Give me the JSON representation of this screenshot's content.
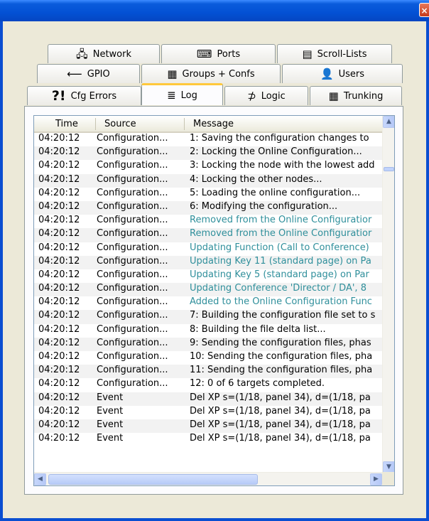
{
  "window": {
    "close_glyph": "×"
  },
  "tabs": {
    "row1": [
      {
        "label": "Network",
        "icon": "network-icon",
        "glyph": "🖧"
      },
      {
        "label": "Ports",
        "icon": "ports-icon",
        "glyph": "⌨"
      },
      {
        "label": "Scroll-Lists",
        "icon": "scroll-lists-icon",
        "glyph": "▤"
      }
    ],
    "row2": [
      {
        "label": "GPIO",
        "icon": "gpio-icon",
        "glyph": "⟵"
      },
      {
        "label": "Groups + Confs",
        "icon": "groups-icon",
        "glyph": "▦"
      },
      {
        "label": "Users",
        "icon": "users-icon",
        "glyph": "👤"
      }
    ],
    "row3": [
      {
        "label": "Cfg Errors",
        "icon": "cfg-errors-icon",
        "glyph": "?!"
      },
      {
        "label": "Log",
        "icon": "log-icon",
        "glyph": "≣"
      },
      {
        "label": "Logic",
        "icon": "logic-icon",
        "glyph": "⊅"
      },
      {
        "label": "Trunking",
        "icon": "trunking-icon",
        "glyph": "▦"
      }
    ],
    "active": "Log"
  },
  "log": {
    "columns": [
      "Time",
      "Source",
      "Message"
    ],
    "rows": [
      {
        "time": "04:20:12",
        "source": "Configuration...",
        "message": "1: Saving the configuration changes to",
        "highlight": false
      },
      {
        "time": "04:20:12",
        "source": "Configuration...",
        "message": "2: Locking the Online Configuration...",
        "highlight": false
      },
      {
        "time": "04:20:12",
        "source": "Configuration...",
        "message": "3: Locking the node with the lowest add",
        "highlight": false
      },
      {
        "time": "04:20:12",
        "source": "Configuration...",
        "message": "4: Locking the other nodes...",
        "highlight": false
      },
      {
        "time": "04:20:12",
        "source": "Configuration...",
        "message": "5: Loading the online configuration...",
        "highlight": false
      },
      {
        "time": "04:20:12",
        "source": "Configuration...",
        "message": "6: Modifying the configuration...",
        "highlight": false
      },
      {
        "time": "04:20:12",
        "source": "Configuration...",
        "message": "Removed from the Online Configuratior",
        "highlight": true
      },
      {
        "time": "04:20:12",
        "source": "Configuration...",
        "message": "Removed from the Online Configuratior",
        "highlight": true
      },
      {
        "time": "04:20:12",
        "source": "Configuration...",
        "message": "Updating Function (Call to Conference)",
        "highlight": true
      },
      {
        "time": "04:20:12",
        "source": "Configuration...",
        "message": "Updating Key 11 (standard page) on Pa",
        "highlight": true
      },
      {
        "time": "04:20:12",
        "source": "Configuration...",
        "message": "Updating Key 5 (standard page) on Par",
        "highlight": true
      },
      {
        "time": "04:20:12",
        "source": "Configuration...",
        "message": "Updating Conference 'Director / DA', 8",
        "highlight": true
      },
      {
        "time": "04:20:12",
        "source": "Configuration...",
        "message": "Added to the Online Configuration Func",
        "highlight": true
      },
      {
        "time": "04:20:12",
        "source": "Configuration...",
        "message": "7: Building the configuration file set to s",
        "highlight": false
      },
      {
        "time": "04:20:12",
        "source": "Configuration...",
        "message": "8: Building the file delta list...",
        "highlight": false
      },
      {
        "time": "04:20:12",
        "source": "Configuration...",
        "message": "9: Sending the configuration files, phas",
        "highlight": false
      },
      {
        "time": "04:20:12",
        "source": "Configuration...",
        "message": "10: Sending the configuration files, pha",
        "highlight": false
      },
      {
        "time": "04:20:12",
        "source": "Configuration...",
        "message": "11: Sending the configuration files, pha",
        "highlight": false
      },
      {
        "time": "04:20:12",
        "source": "Configuration...",
        "message": "12: 0 of 6 targets completed.",
        "highlight": false
      },
      {
        "time": "04:20:12",
        "source": "Event",
        "message": "Del XP s=(1/18, panel 34), d=(1/18, pa",
        "highlight": false
      },
      {
        "time": "04:20:12",
        "source": "Event",
        "message": "Del XP s=(1/18, panel 34), d=(1/18, pa",
        "highlight": false
      },
      {
        "time": "04:20:12",
        "source": "Event",
        "message": "Del XP s=(1/18, panel 34), d=(1/18, pa",
        "highlight": false
      },
      {
        "time": "04:20:12",
        "source": "Event",
        "message": "Del XP s=(1/18, panel 34), d=(1/18, pa",
        "highlight": false
      }
    ]
  },
  "colors": {
    "titlebar": "#0a5bdc",
    "highlight_text": "#2f8f9b",
    "active_tab_accent": "#ffc83c"
  }
}
